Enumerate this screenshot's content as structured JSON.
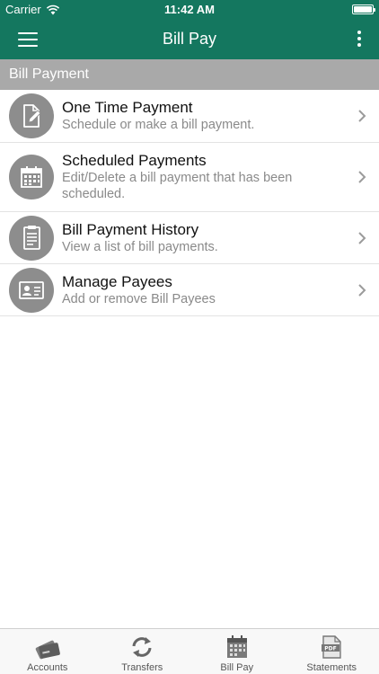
{
  "status_bar": {
    "carrier": "Carrier",
    "time": "11:42 AM"
  },
  "nav": {
    "title": "Bill Pay",
    "menu_icon": "hamburger-menu-icon",
    "more_icon": "more-vertical-icon"
  },
  "section": {
    "title": "Bill Payment"
  },
  "items": [
    {
      "title": "One Time Payment",
      "subtitle": "Schedule or make a bill payment.",
      "icon": "edit-document-icon"
    },
    {
      "title": "Scheduled Payments",
      "subtitle": "Edit/Delete a bill payment that has been scheduled.",
      "icon": "calendar-icon"
    },
    {
      "title": "Bill Payment History",
      "subtitle": "View a list of bill payments.",
      "icon": "document-list-icon"
    },
    {
      "title": "Manage Payees",
      "subtitle": "Add or remove Bill Payees",
      "icon": "id-card-icon"
    }
  ],
  "tabs": [
    {
      "label": "Accounts",
      "icon": "cards-icon"
    },
    {
      "label": "Transfers",
      "icon": "refresh-arrows-icon"
    },
    {
      "label": "Bill Pay",
      "icon": "calendar-icon"
    },
    {
      "label": "Statements",
      "icon": "pdf-document-icon"
    }
  ],
  "colors": {
    "brand": "#14775f",
    "section_header": "#a9a9a9",
    "icon_circle": "#8d8d8d"
  }
}
